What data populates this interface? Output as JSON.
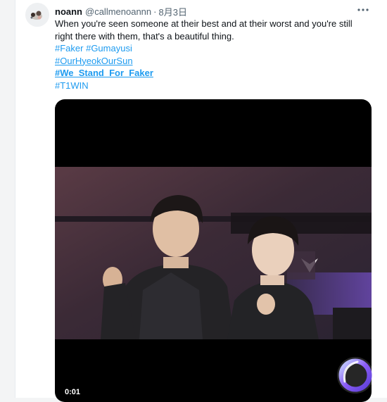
{
  "tweet": {
    "display_name": "noann",
    "handle": "@callmenoannn",
    "separator": "·",
    "date": "8月3日",
    "text": "When you're seen someone at their best and at their worst and you're still right there with them, that's a beautiful thing.",
    "hashtags": [
      {
        "text": "#Faker",
        "style": "plain"
      },
      {
        "text": "#Gumayusi",
        "style": "plain"
      },
      {
        "text": "#OurHyeokOurSun",
        "style": "underline"
      },
      {
        "text": "#We_Stand_For_Faker",
        "style": "bold"
      },
      {
        "text": "#T1WIN",
        "style": "plain"
      }
    ]
  },
  "media": {
    "type": "video",
    "timestamp": "0:01"
  },
  "colors": {
    "link": "#1d9bf0",
    "secondary_text": "#536471",
    "primary_text": "#0f1419",
    "background": "#ffffff"
  },
  "icons": {
    "more": "more-horizontal-icon",
    "watermark": "ring-logo-icon"
  }
}
